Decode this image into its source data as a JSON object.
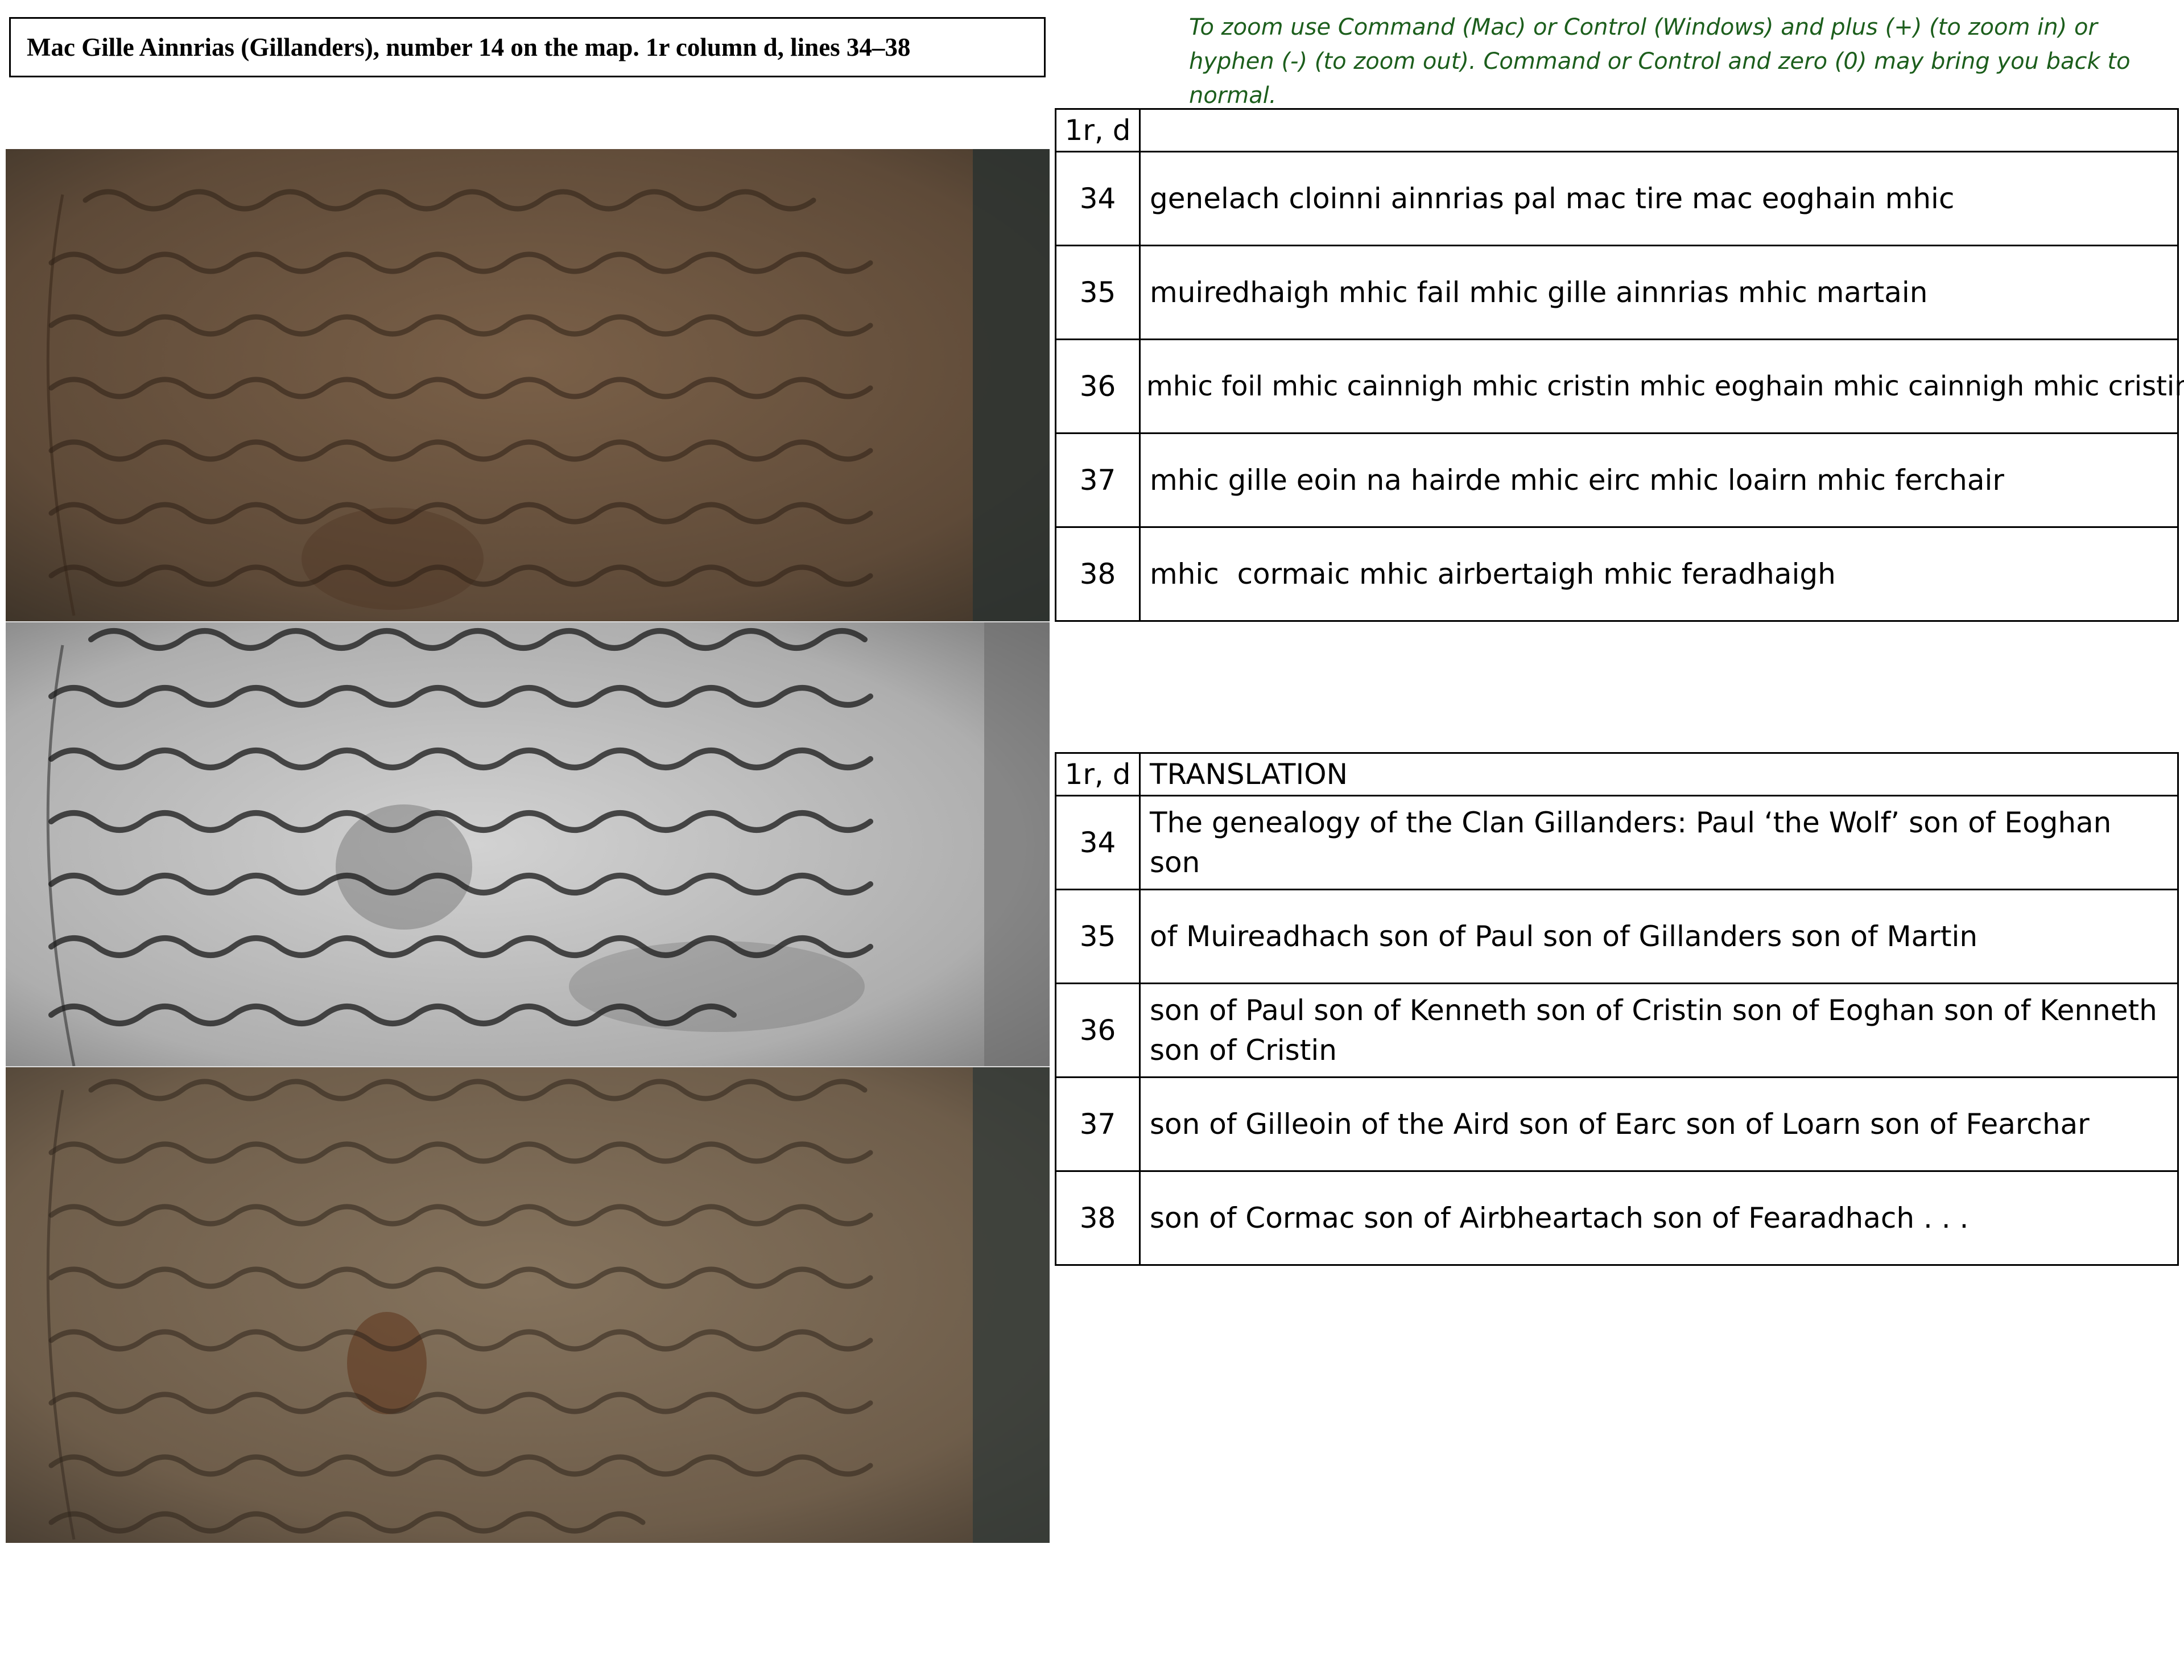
{
  "header": {
    "title": "Mac Gille Ainnrias (Gillanders), number 14 on the map. 1r column d, lines 34–38",
    "zoom_note": "To zoom use Command (Mac) or Control (Windows) and plus (+) (to zoom in) or hyphen (-) (to zoom out).  Command or Control and zero (0) may bring you back to normal."
  },
  "transcription_table": {
    "header_ref": "1r, d",
    "header_text": "",
    "rows": [
      {
        "line": "34",
        "text": "genelach cloinni ainnrias pal mac tire mac eoghain mhic"
      },
      {
        "line": "35",
        "text": "muiredhaigh mhic fail mhic gille ainnrias mhic martain"
      },
      {
        "line": "36",
        "text": "mhic foil mhic cainnigh mhic cristin mhic eoghain mhic cainnigh mhic cristin"
      },
      {
        "line": "37",
        "text": "mhic gille eoin na hairde mhic eirc mhic loairn mhic ferchair"
      },
      {
        "line": "38",
        "text": "mhic  cormaic mhic airbertaigh mhic feradhaigh"
      }
    ]
  },
  "translation_table": {
    "header_ref": "1r, d",
    "header_text": "TRANSLATION",
    "rows": [
      {
        "line": "34",
        "text": "The genealogy of the Clan Gillanders: Paul ‘the Wolf’ son of Eoghan son"
      },
      {
        "line": "35",
        "text": "of Muireadhach son of Paul son of Gillanders son of Martin"
      },
      {
        "line": "36",
        "text": "son of Paul son of Kenneth son of Cristin son of Eoghan son of Kenneth son of Cristin"
      },
      {
        "line": "37",
        "text": "son of Gilleoin of the Aird son of Earc son of Loarn son of Fearchar"
      },
      {
        "line": "38",
        "text": "son of Cormac son of Airbheartach son of Fearadhach . . ."
      }
    ]
  },
  "colors": {
    "zoom_note": "#1c5e1c",
    "parchment_colour": "#6b5440",
    "parchment_grey": "#b9b9b9",
    "parchment_enhanced": "#7c6a55"
  }
}
